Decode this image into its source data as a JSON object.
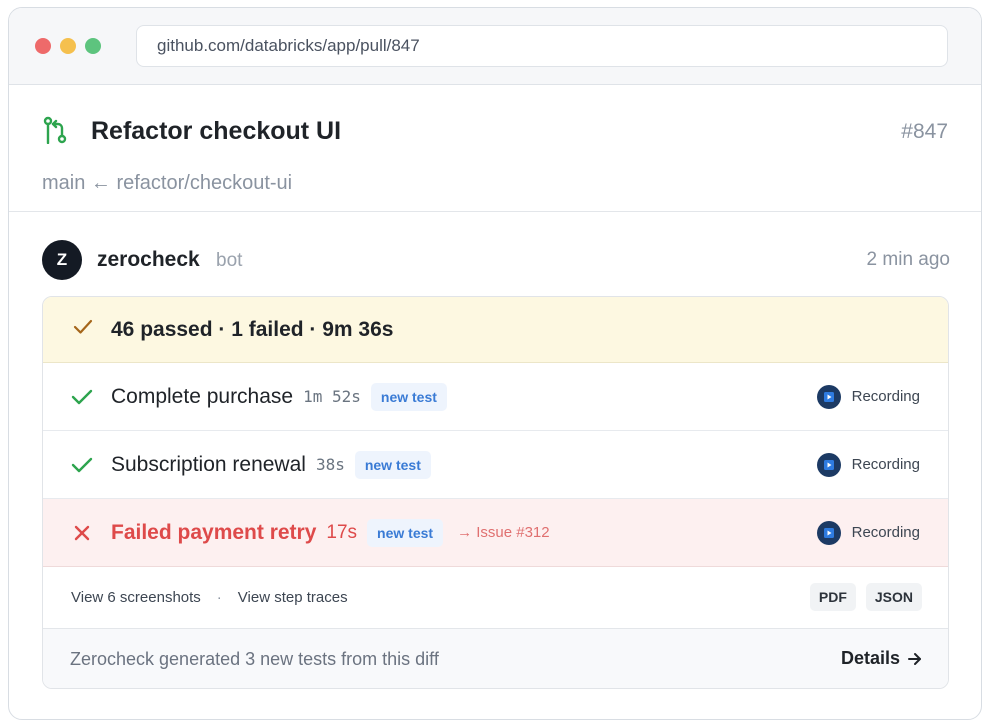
{
  "browser": {
    "url": "github.com/databricks/app/pull/847"
  },
  "pull_request": {
    "title": "Refactor checkout UI",
    "number": "#847",
    "branch": "main ← refactor/checkout-ui"
  },
  "comment": {
    "avatar_letter": "Z",
    "author": "zerocheck",
    "badge": "bot",
    "timestamp": "2 min ago"
  },
  "summary": {
    "text": "46 passed · 1 failed · 9m 36s"
  },
  "tests": [
    {
      "status": "passed",
      "name": "Complete purchase",
      "duration": "1m 52s",
      "tag": "new test",
      "recording_label": "Recording"
    },
    {
      "status": "passed",
      "name": "Subscription renewal",
      "duration": "38s",
      "tag": "new test",
      "recording_label": "Recording"
    },
    {
      "status": "failed",
      "name": "Failed payment retry",
      "duration": "17s",
      "tag": "new test",
      "issue": "→ Issue #312",
      "recording_label": "Recording"
    }
  ],
  "links": {
    "screenshots": "View 6 screenshots",
    "separator": "·",
    "traces": "View step traces",
    "pdf": "PDF",
    "json": "JSON"
  },
  "footer": {
    "text": "Zerocheck generated 3 new tests from this diff",
    "details": "Details"
  },
  "colors": {
    "pass": "#2da44e",
    "fail": "#de4a4a",
    "summary_bg": "#fdf8e1",
    "tag_text": "#3a7bd5",
    "pr_icon": "#2da44e"
  }
}
